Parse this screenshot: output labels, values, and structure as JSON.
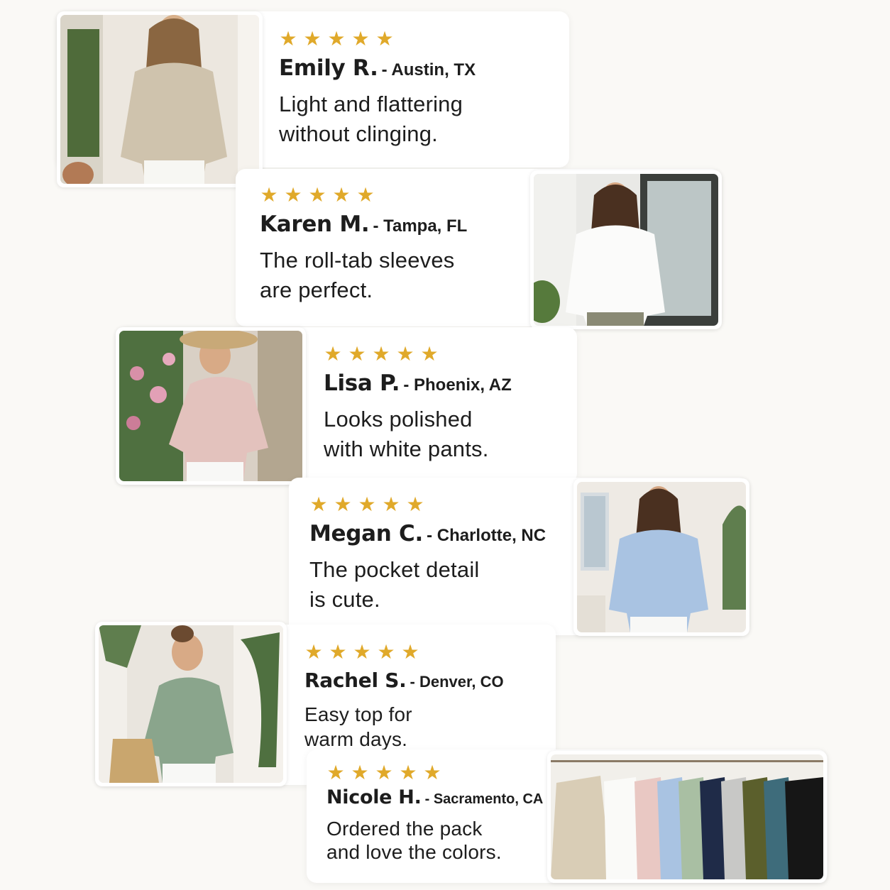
{
  "colors": {
    "star": "#e0a92a",
    "background": "#faf9f6",
    "card": "#ffffff"
  },
  "star_glyph": "★",
  "reviews": [
    {
      "rating": 5,
      "name": "Emily R.",
      "location": "- Austin, TX",
      "quote_line1": "Light and flattering",
      "quote_line2": "without clinging.",
      "photo": "woman-beige-linen-shirt-photo"
    },
    {
      "rating": 5,
      "name": "Karen M.",
      "location": "- Tampa, FL",
      "quote_line1": "The roll-tab sleeves",
      "quote_line2": "are perfect.",
      "photo": "woman-white-linen-shirt-photo"
    },
    {
      "rating": 5,
      "name": "Lisa P.",
      "location": "- Phoenix, AZ",
      "quote_line1": "Looks polished",
      "quote_line2": "with white pants.",
      "photo": "woman-pink-linen-shirt-photo"
    },
    {
      "rating": 5,
      "name": "Megan C.",
      "location": "- Charlotte, NC",
      "quote_line1": "The pocket detail",
      "quote_line2": "is cute.",
      "photo": "woman-blue-linen-shirt-photo"
    },
    {
      "rating": 5,
      "name": "Rachel S.",
      "location": "- Denver, CO",
      "quote_line1": "Easy top for",
      "quote_line2": "warm days.",
      "photo": "woman-sage-linen-shirt-photo"
    },
    {
      "rating": 5,
      "name": "Nicole H.",
      "location": "- Sacramento, CA",
      "quote_line1": "Ordered the pack",
      "quote_line2": "and love the colors.",
      "photo": "shirt-color-pack-photo"
    }
  ]
}
